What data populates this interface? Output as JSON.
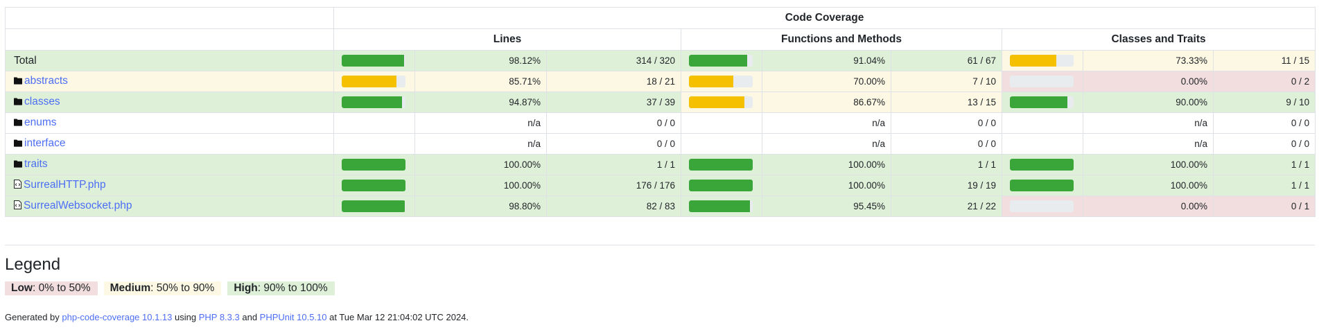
{
  "header": {
    "group_title": "Code Coverage",
    "col_lines": "Lines",
    "col_functions": "Functions and Methods",
    "col_classes": "Classes and Traits"
  },
  "rows": [
    {
      "name": "Total",
      "icon": "none",
      "link": false,
      "lines": {
        "fraction": 0.9812,
        "level": "high",
        "bg": "high",
        "pct": "98.12%",
        "count": "314 / 320"
      },
      "funcs": {
        "fraction": 0.9104,
        "level": "high",
        "bg": "high",
        "pct": "91.04%",
        "count": "61 / 67"
      },
      "classes": {
        "fraction": 0.7333,
        "level": "med",
        "bg": "med",
        "pct": "73.33%",
        "count": "11 / 15"
      },
      "rowbg": "high"
    },
    {
      "name": "abstracts",
      "icon": "folder-icon",
      "link": true,
      "lines": {
        "fraction": 0.8571,
        "level": "med",
        "bg": "med",
        "pct": "85.71%",
        "count": "18 / 21"
      },
      "funcs": {
        "fraction": 0.7,
        "level": "med",
        "bg": "med",
        "pct": "70.00%",
        "count": "7 / 10"
      },
      "classes": {
        "fraction": 0.0,
        "level": "low",
        "bg": "low",
        "pct": "0.00%",
        "count": "0 / 2"
      },
      "rowbg": "med"
    },
    {
      "name": "classes",
      "icon": "folder-icon",
      "link": true,
      "lines": {
        "fraction": 0.9487,
        "level": "high",
        "bg": "high",
        "pct": "94.87%",
        "count": "37 / 39"
      },
      "funcs": {
        "fraction": 0.8667,
        "level": "med",
        "bg": "med",
        "pct": "86.67%",
        "count": "13 / 15"
      },
      "classes": {
        "fraction": 0.9,
        "level": "high",
        "bg": "high",
        "pct": "90.00%",
        "count": "9 / 10"
      },
      "rowbg": "high"
    },
    {
      "name": "enums",
      "icon": "folder-icon",
      "link": true,
      "lines": {
        "fraction": null,
        "level": "none",
        "bg": "none",
        "pct": "n/a",
        "count": "0 / 0"
      },
      "funcs": {
        "fraction": null,
        "level": "none",
        "bg": "none",
        "pct": "n/a",
        "count": "0 / 0"
      },
      "classes": {
        "fraction": null,
        "level": "none",
        "bg": "none",
        "pct": "n/a",
        "count": "0 / 0"
      },
      "rowbg": "none"
    },
    {
      "name": "interface",
      "icon": "folder-icon",
      "link": true,
      "lines": {
        "fraction": null,
        "level": "none",
        "bg": "none",
        "pct": "n/a",
        "count": "0 / 0"
      },
      "funcs": {
        "fraction": null,
        "level": "none",
        "bg": "none",
        "pct": "n/a",
        "count": "0 / 0"
      },
      "classes": {
        "fraction": null,
        "level": "none",
        "bg": "none",
        "pct": "n/a",
        "count": "0 / 0"
      },
      "rowbg": "none"
    },
    {
      "name": "traits",
      "icon": "folder-icon",
      "link": true,
      "lines": {
        "fraction": 1.0,
        "level": "high",
        "bg": "high",
        "pct": "100.00%",
        "count": "1 / 1"
      },
      "funcs": {
        "fraction": 1.0,
        "level": "high",
        "bg": "high",
        "pct": "100.00%",
        "count": "1 / 1"
      },
      "classes": {
        "fraction": 1.0,
        "level": "high",
        "bg": "high",
        "pct": "100.00%",
        "count": "1 / 1"
      },
      "rowbg": "high"
    },
    {
      "name": "SurrealHTTP.php",
      "icon": "file-code-icon",
      "link": true,
      "lines": {
        "fraction": 1.0,
        "level": "high",
        "bg": "high",
        "pct": "100.00%",
        "count": "176 / 176"
      },
      "funcs": {
        "fraction": 1.0,
        "level": "high",
        "bg": "high",
        "pct": "100.00%",
        "count": "19 / 19"
      },
      "classes": {
        "fraction": 1.0,
        "level": "high",
        "bg": "high",
        "pct": "100.00%",
        "count": "1 / 1"
      },
      "rowbg": "high"
    },
    {
      "name": "SurrealWebsocket.php",
      "icon": "file-code-icon",
      "link": true,
      "lines": {
        "fraction": 0.988,
        "level": "high",
        "bg": "high",
        "pct": "98.80%",
        "count": "82 / 83"
      },
      "funcs": {
        "fraction": 0.9545,
        "level": "high",
        "bg": "high",
        "pct": "95.45%",
        "count": "21 / 22"
      },
      "classes": {
        "fraction": 0.0,
        "level": "low",
        "bg": "low",
        "pct": "0.00%",
        "count": "0 / 1"
      },
      "rowbg": "high"
    }
  ],
  "legend": {
    "title": "Legend",
    "low_label": "Low",
    "low_range": ": 0% to 50%",
    "medium_label": "Medium",
    "medium_range": ": 50% to 90%",
    "high_label": "High",
    "high_range": ": 90% to 100%"
  },
  "footer": {
    "prefix": "Generated by ",
    "tool": "php-code-coverage 10.1.13",
    "using": " using ",
    "php": "PHP 8.3.3",
    "and": " and ",
    "phpunit": "PHPUnit 10.5.10",
    "suffix": " at Tue Mar 12 21:04:02 UTC 2024."
  },
  "colors": {
    "high_bg": "#dff0d8",
    "medium_bg": "#fcf8e3",
    "low_bg": "#f2dede",
    "high_bar": "#3aa63a",
    "medium_bar": "#f5c000",
    "link": "#4c6ef5"
  }
}
